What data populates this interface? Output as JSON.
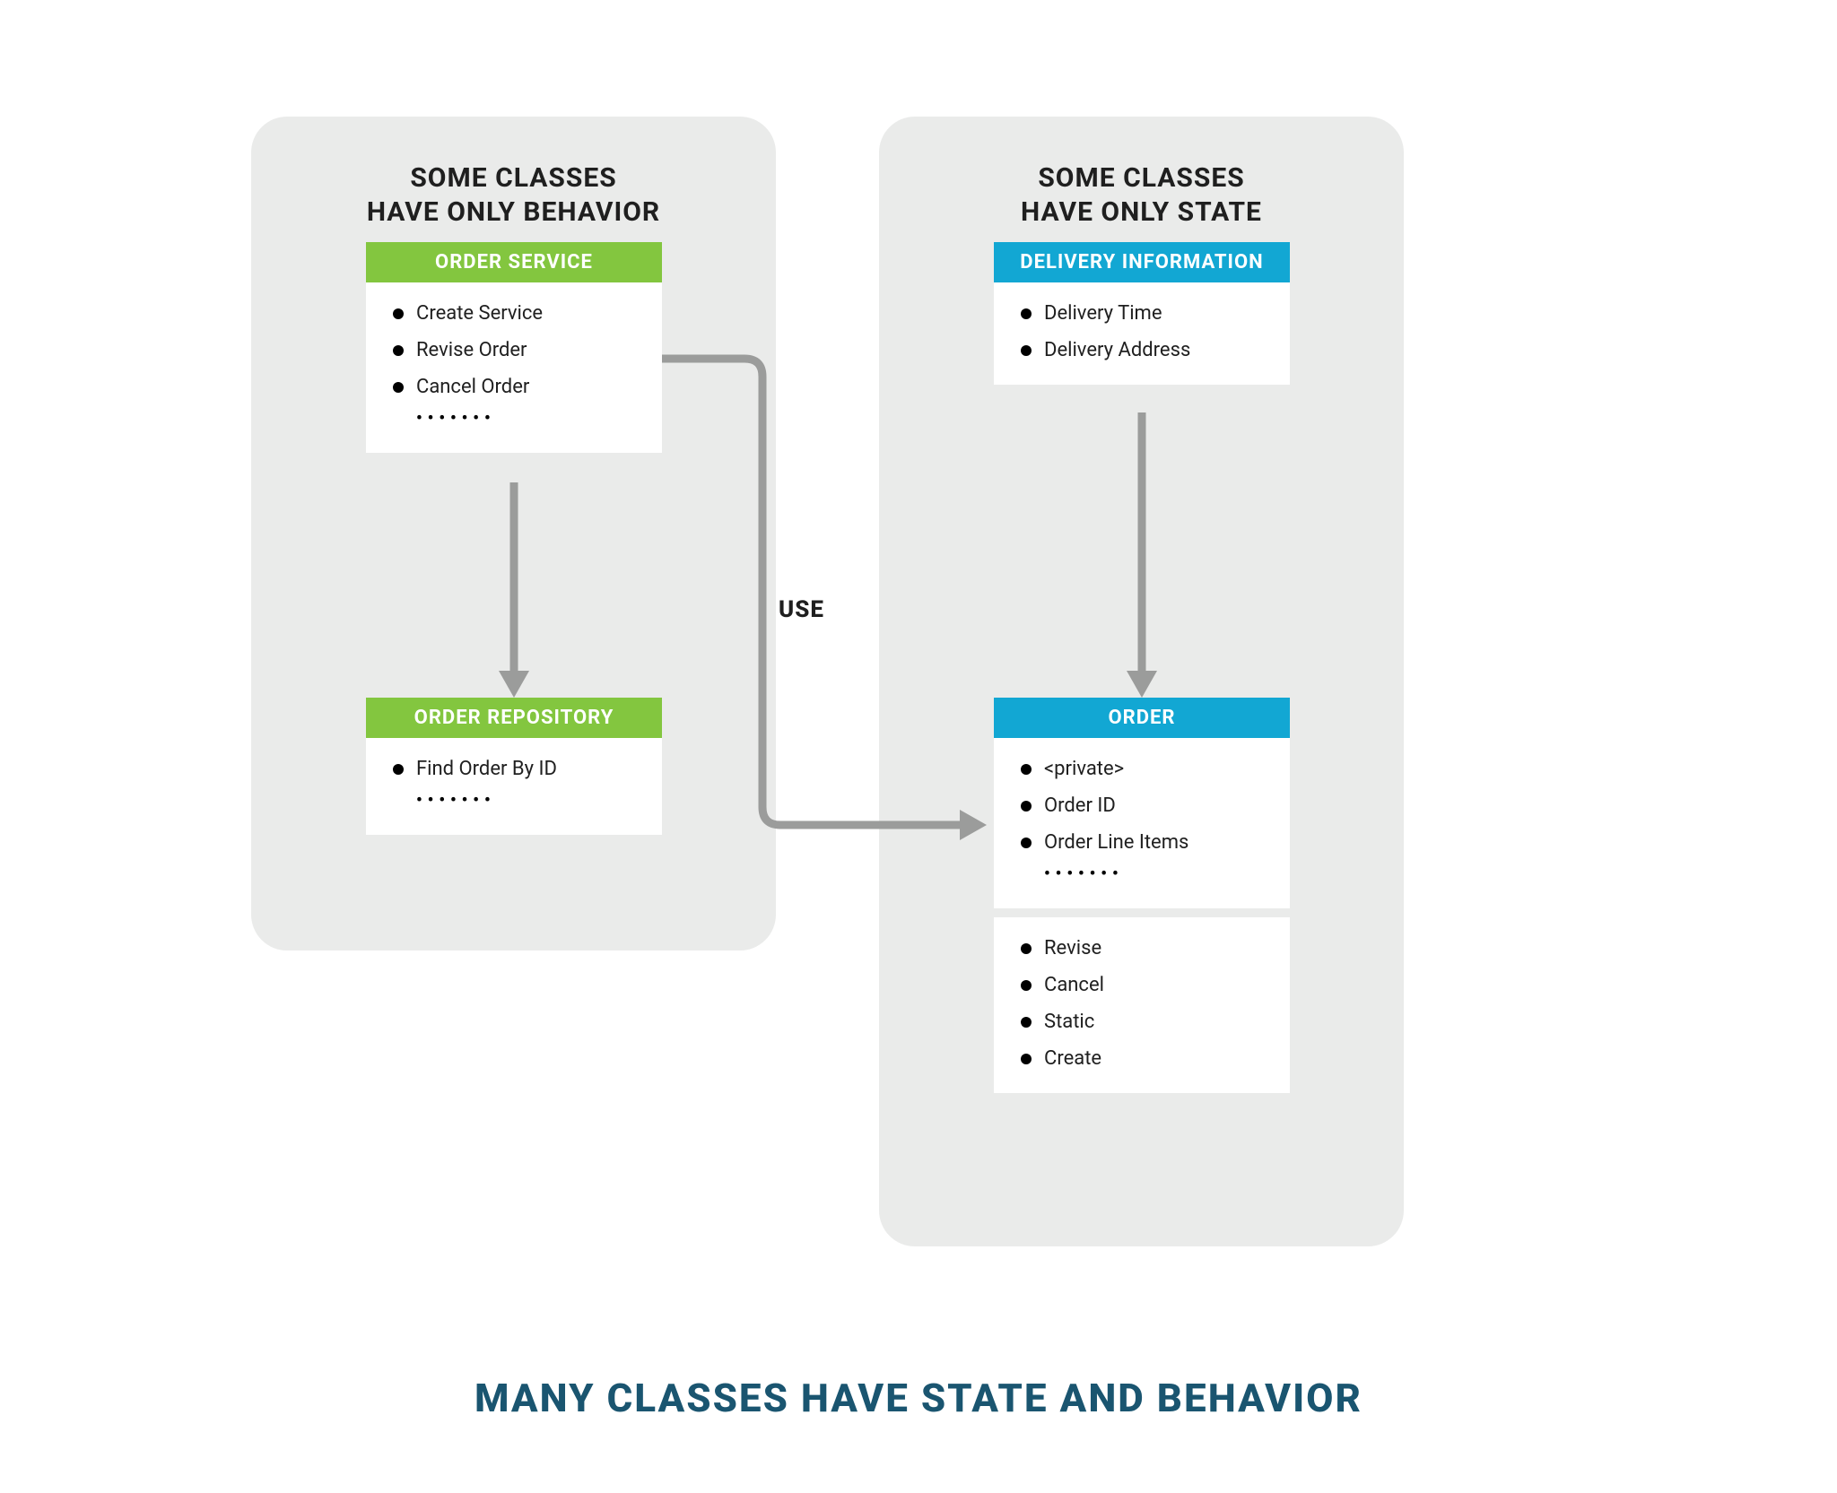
{
  "colors": {
    "panel_bg": "#eaebea",
    "green": "#83c63f",
    "blue": "#12a7d3",
    "footer": "#1a5570",
    "arrow": "#9b9c9b"
  },
  "left_panel": {
    "title_line1": "Some Classes",
    "title_line2": "Have Only Behavior"
  },
  "right_panel": {
    "title_line1": "Some Classes",
    "title_line2": "Have Only State"
  },
  "order_service": {
    "header": "Order Service",
    "items": [
      "Create Service",
      "Revise Order",
      "Cancel Order"
    ],
    "has_ellipsis": true
  },
  "order_repository": {
    "header": "Order Repository",
    "items": [
      "Find Order By ID"
    ],
    "has_ellipsis": true
  },
  "delivery_info": {
    "header": "Delivery Information",
    "items": [
      "Delivery Time",
      "Delivery Address"
    ],
    "has_ellipsis": false
  },
  "order": {
    "header": "Order",
    "section1_items": [
      "<private>",
      "Order ID",
      "Order Line Items"
    ],
    "section1_has_ellipsis": true,
    "section2_items": [
      "Revise",
      "Cancel",
      "Static",
      "Create"
    ]
  },
  "labels": {
    "use": "USE",
    "ellipsis": "•••••••"
  },
  "footer": "Many Classes Have State and Behavior"
}
